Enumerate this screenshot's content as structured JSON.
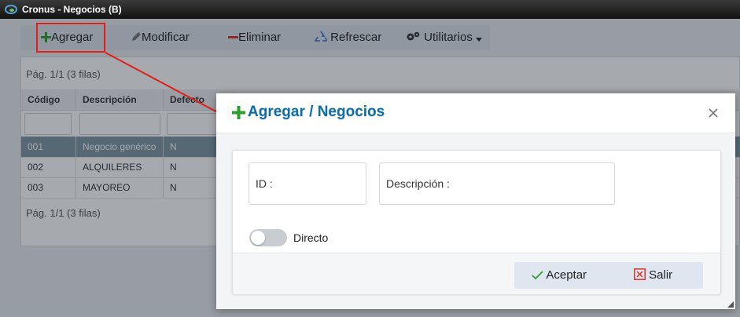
{
  "window": {
    "title": "Cronus - Negocios (B)"
  },
  "toolbar": {
    "add_label": "Agregar",
    "edit_label": "Modificar",
    "delete_label": "Eliminar",
    "refresh_label": "Refrescar",
    "utilities_label": "Utilitarios"
  },
  "grid": {
    "pagination_top": "Pág. 1/1 (3 filas)",
    "pagination_bottom": "Pág. 1/1 (3 filas)",
    "columns": [
      "Código",
      "Descripción",
      "Defecto"
    ],
    "rows": [
      {
        "code": "001",
        "description": "Negocio genérico",
        "default": "N",
        "selected": true
      },
      {
        "code": "002",
        "description": "ALQUILERES",
        "default": "N",
        "selected": false
      },
      {
        "code": "003",
        "description": "MAYOREO",
        "default": "N",
        "selected": false
      }
    ]
  },
  "modal": {
    "title": "Agregar / Negocios",
    "id_label": "ID :",
    "description_label": "Descripción :",
    "toggle_label": "Directo",
    "toggle_on": false,
    "accept_label": "Aceptar",
    "exit_label": "Salir"
  },
  "colors": {
    "accent_green": "#2e9e2e",
    "title_blue": "#0f6da8",
    "delete_red": "#d9342b",
    "refresh_blue": "#3a6fd8",
    "annotation_red": "#e0201a"
  },
  "icons": [
    "plus-icon",
    "pencil-icon",
    "minus-icon",
    "recycle-icon",
    "gears-icon",
    "caret-down-icon",
    "close-icon",
    "check-icon",
    "x-box-icon"
  ]
}
